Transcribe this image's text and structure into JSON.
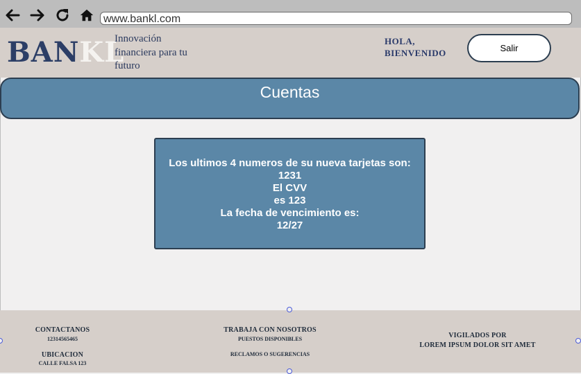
{
  "browser": {
    "url": "www.bankl.com"
  },
  "header": {
    "logo_primary": "BAN",
    "logo_secondary": "KL",
    "tagline": "Innovación financiera para tu futuro",
    "greeting_line1": "Hola,",
    "greeting_line2": "Bienvenido",
    "logout_label": "Salir"
  },
  "section": {
    "title": "Cuentas"
  },
  "card_info": {
    "line1": "Los ultimos 4 numeros de su nueva tarjetas son:",
    "line2": "1231",
    "line3": "El CVV",
    "line4": "es 123",
    "line5": "La fecha de vencimiento es:",
    "line6": "12/27"
  },
  "footer": {
    "contact_title": "Contactanos",
    "contact_phone": "12314565465",
    "location_title": "Ubicacion",
    "location_address": "Calle Falsa 123",
    "jobs_title": "Trabaja Con Nosotros",
    "jobs_sub": "Puestos disponibles",
    "claims": "Reclamos o Sugerencias",
    "supervised_title": "Vigilados por",
    "supervised_text": "Lorem ipsum dolor sit amet"
  },
  "colors": {
    "primary_blue": "#5b87a7",
    "dark_navy": "#2c3e50",
    "header_bg": "#d6cfca"
  }
}
